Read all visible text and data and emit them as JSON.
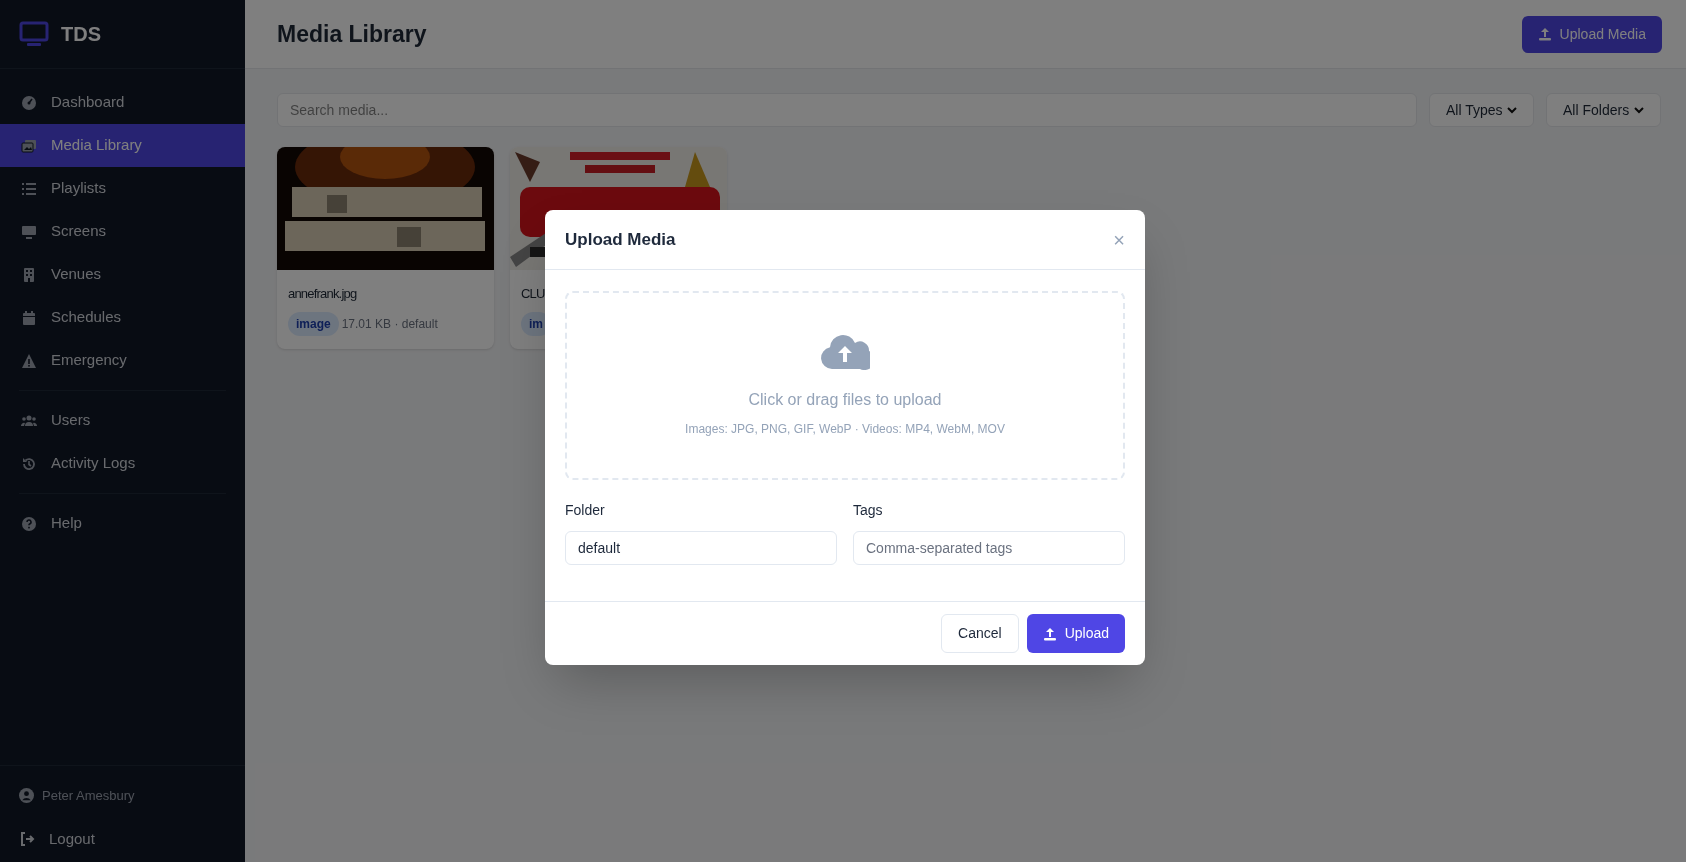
{
  "sidebar": {
    "logo": "TDS",
    "groups": [
      [
        {
          "label": "Dashboard",
          "kind": "gauge",
          "selected": false
        },
        {
          "label": "Media Library",
          "kind": "images",
          "selected": true
        },
        {
          "label": "Playlists",
          "kind": "list",
          "selected": false
        },
        {
          "label": "Screens",
          "kind": "monitor",
          "selected": false
        },
        {
          "label": "Venues",
          "kind": "building",
          "selected": false
        },
        {
          "label": "Schedules",
          "kind": "calendar",
          "selected": false
        },
        {
          "label": "Emergency",
          "kind": "warning",
          "selected": false
        }
      ],
      [
        {
          "label": "Users",
          "kind": "users",
          "selected": false
        },
        {
          "label": "Activity Logs",
          "kind": "history",
          "selected": false
        }
      ],
      [
        {
          "label": "Help",
          "kind": "help",
          "selected": false
        }
      ]
    ],
    "user": "Peter Amesbury",
    "logout": "Logout"
  },
  "header": {
    "title": "Media Library",
    "upload_button": "Upload Media"
  },
  "filters": {
    "search_placeholder": "Search media...",
    "type_select": "All Types",
    "folder_select": "All Folders"
  },
  "media": [
    {
      "name": "annefrank.jpg",
      "badge": "image",
      "meta": "17.01 KB · default"
    },
    {
      "name": "CLU",
      "badge": "im"
    }
  ],
  "modal": {
    "title": "Upload Media",
    "close": "×",
    "dropzone_title": "Click or drag files to upload",
    "dropzone_hint": "Images: JPG, PNG, GIF, WebP · Videos: MP4, WebM, MOV",
    "folder_label": "Folder",
    "folder_value": "default",
    "tags_label": "Tags",
    "tags_placeholder": "Comma-separated tags",
    "cancel": "Cancel",
    "upload": "Upload"
  }
}
